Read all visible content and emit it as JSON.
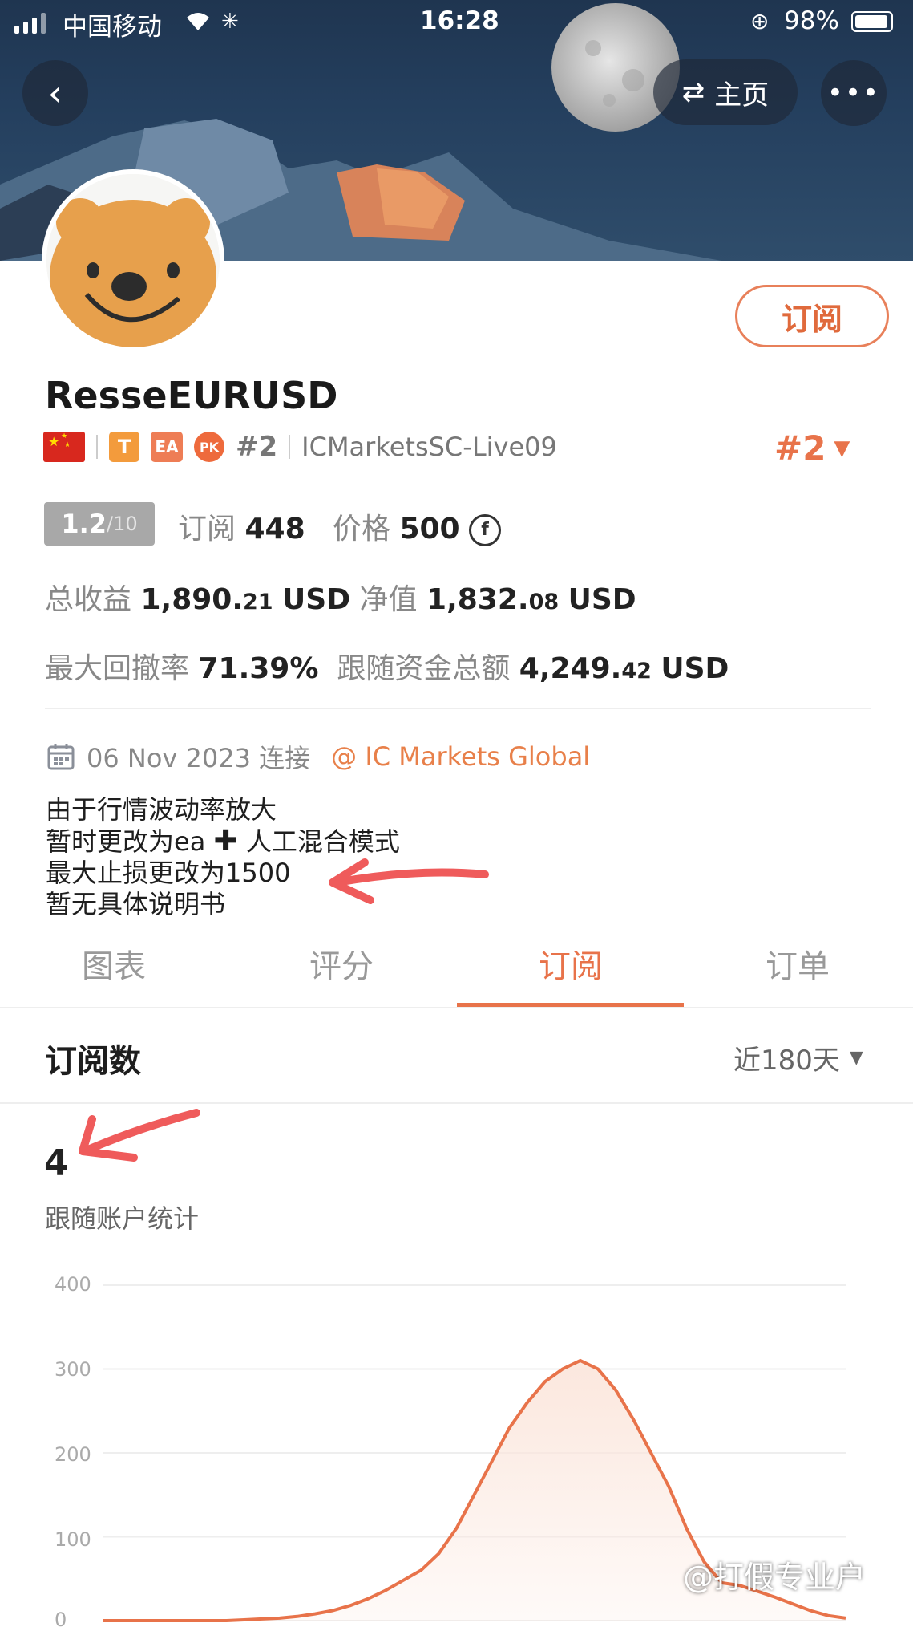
{
  "status_bar": {
    "carrier": "中国移动",
    "time": "16:28",
    "battery": "98%"
  },
  "header": {
    "back_icon": "chevron-left-icon",
    "switch_label": "主页",
    "more_icon": "ellipsis-icon"
  },
  "profile": {
    "username": "ResseEURUSD",
    "subscribe_label": "订阅",
    "badges": {
      "flag": "CN",
      "t_badge": "T",
      "ea_badge": "EA",
      "pk_badge": "PK",
      "rank": "#2",
      "server": "ICMarketsSC-Live09"
    },
    "rank_right": "#2"
  },
  "stats": {
    "score_main": "1.2",
    "score_den": "/10",
    "subscribe_label": "订阅",
    "subscribe_count": "448",
    "price_label": "价格",
    "price_value": "500",
    "total_profit_label": "总收益",
    "total_profit_main": "1,890.",
    "total_profit_dec": "21",
    "total_profit_unit": "USD",
    "equity_label": "净值",
    "equity_main": "1,832.",
    "equity_dec": "08",
    "equity_unit": "USD",
    "drawdown_label": "最大回撤率",
    "drawdown_value": "71.39%",
    "follow_funds_label": "跟随资金总额",
    "follow_funds_main": "4,249.",
    "follow_funds_dec": "42",
    "follow_funds_unit": "USD"
  },
  "connection": {
    "date": "06 Nov 2023 连接",
    "broker": "@ IC Markets Global"
  },
  "description": {
    "line1": "由于行情波动率放大",
    "line2a": "暂时更改为ea",
    "line2b": "人工混合模式",
    "line3": "最大止损更改为1500",
    "line4": "暂无具体说明书"
  },
  "tabs": [
    {
      "label": "图表"
    },
    {
      "label": "评分"
    },
    {
      "label": "订阅"
    },
    {
      "label": "订单"
    }
  ],
  "subscriptions": {
    "title": "订阅数",
    "range": "近180天",
    "count": "4",
    "caption": "跟随账户统计"
  },
  "chart_data": {
    "type": "area",
    "ylim": [
      0,
      400
    ],
    "yticks": [
      "400",
      "300",
      "200",
      "100",
      "0"
    ],
    "series": [
      {
        "values": [
          0,
          0,
          0,
          0,
          0,
          0,
          0,
          0,
          1,
          2,
          3,
          5,
          8,
          12,
          18,
          26,
          36,
          48,
          60,
          80,
          110,
          150,
          190,
          230,
          260,
          285,
          300,
          310,
          300,
          275,
          240,
          200,
          160,
          110,
          70,
          45,
          42,
          35,
          28,
          20,
          12,
          6,
          3
        ]
      }
    ],
    "colors": {
      "line": "#e8734a",
      "fill": "#fbe6dc"
    }
  },
  "watermark": "@打假专业户"
}
